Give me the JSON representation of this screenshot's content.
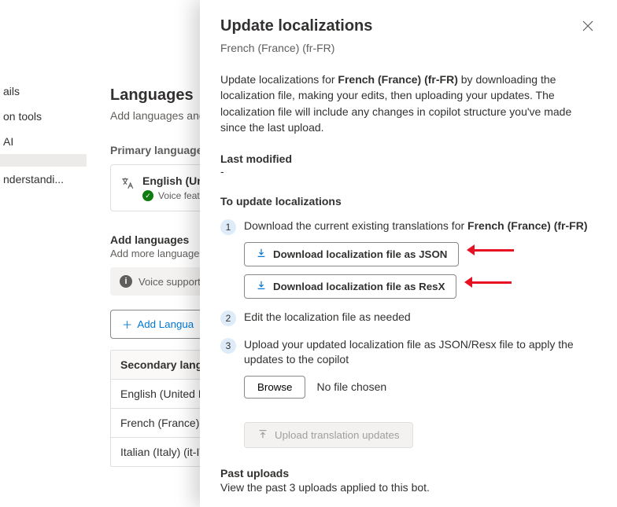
{
  "sidebar": {
    "items": [
      {
        "label": "ails"
      },
      {
        "label": "on tools"
      },
      {
        "label": "AI",
        "selected": true
      },
      {
        "label": ""
      },
      {
        "label": "nderstandi..."
      }
    ]
  },
  "main": {
    "title": "Languages",
    "subtitle": "Add languages and c",
    "primary_label": "Primary language",
    "primary_lang": {
      "name": "English (Unit",
      "voice": "Voice feat"
    },
    "add_label": "Add languages",
    "add_sub": "Add more languages",
    "voice_info": "Voice support is",
    "add_btn": "Add Langua",
    "sec_header": "Secondary langua",
    "sec_rows": [
      "English (United Kin",
      "French (France) (fr-",
      "Italian (Italy) (it-IT)"
    ]
  },
  "panel": {
    "title": "Update localizations",
    "subtitle": "French (France) (fr-FR)",
    "intro_pre": "Update localizations for ",
    "intro_lang": "French (France) (fr-FR)",
    "intro_post": " by downloading the localization file, making your edits, then uploading your updates. The localization file will include any changes in copilot structure you've made since the last upload.",
    "lm_label": "Last modified",
    "lm_value": "-",
    "steps_title": "To update localizations",
    "step1_pre": "Download the current existing translations for ",
    "step1_lang": "French (France) (fr-FR)",
    "dl_json": "Download localization file as JSON",
    "dl_resx": "Download localization file as ResX",
    "step2": "Edit the localization file as needed",
    "step3": "Upload your updated localization file as JSON/Resx file to apply the updates to the copilot",
    "browse": "Browse",
    "nofile": "No file chosen",
    "upload": "Upload translation updates",
    "past_title": "Past uploads",
    "past_sub": "View the past 3 uploads applied to this bot."
  }
}
